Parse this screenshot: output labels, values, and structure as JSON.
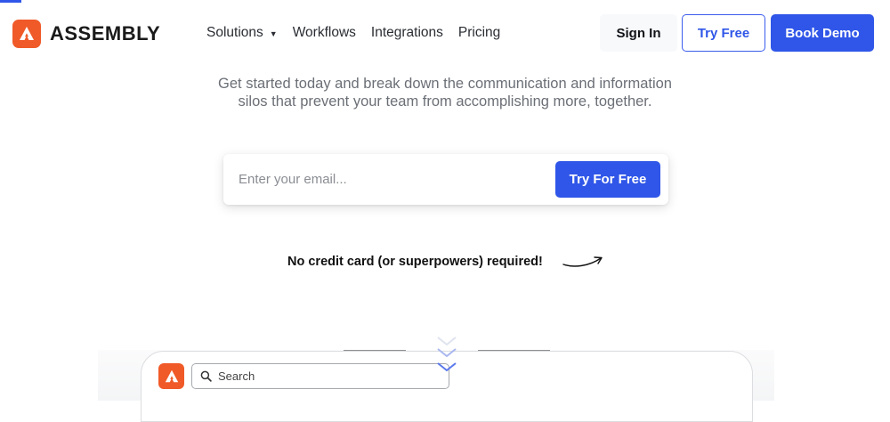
{
  "header": {
    "logo_text": "ASSEMBLY",
    "nav": [
      {
        "label": "Solutions",
        "has_dropdown": true
      },
      {
        "label": "Workflows"
      },
      {
        "label": "Integrations"
      },
      {
        "label": "Pricing"
      }
    ],
    "sign_in_label": "Sign In",
    "try_free_label": "Try Free",
    "book_demo_label": "Book Demo"
  },
  "hero": {
    "subtitle_line1": "Get started today and break down the communication and information",
    "subtitle_line2": "silos that prevent your team from accomplishing more, together."
  },
  "signup": {
    "email_placeholder": "Enter your email...",
    "email_value": "",
    "submit_label": "Try For Free",
    "note": "No credit card (or superpowers) required!"
  },
  "preview": {
    "search_placeholder": "Search"
  },
  "colors": {
    "brand_orange": "#f05a28",
    "primary_blue": "#2f56e8"
  },
  "icons": [
    "assembly-logo-icon",
    "caret-down-icon",
    "curved-arrow-icon",
    "search-icon",
    "chevron-down-icon"
  ]
}
